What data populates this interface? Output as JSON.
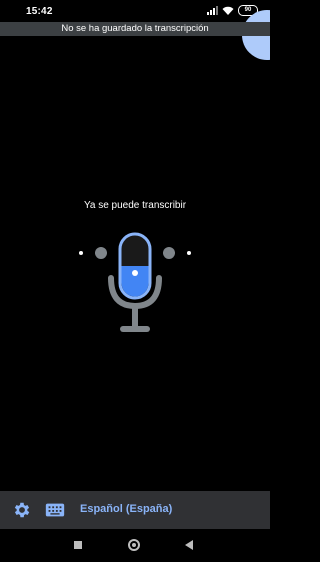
{
  "status_bar": {
    "time": "15:42",
    "battery": "90"
  },
  "banner": {
    "text": "No se ha guardado la transcripción"
  },
  "main": {
    "status_text": "Ya se puede transcribir"
  },
  "bottom_bar": {
    "language": "Español (España)"
  },
  "colors": {
    "accent": "#8ab4f8",
    "mic_fill": "#4285f4",
    "banner_bg": "#3c4043",
    "bottom_bar_bg": "#303134",
    "mic_grey": "#80868b"
  }
}
